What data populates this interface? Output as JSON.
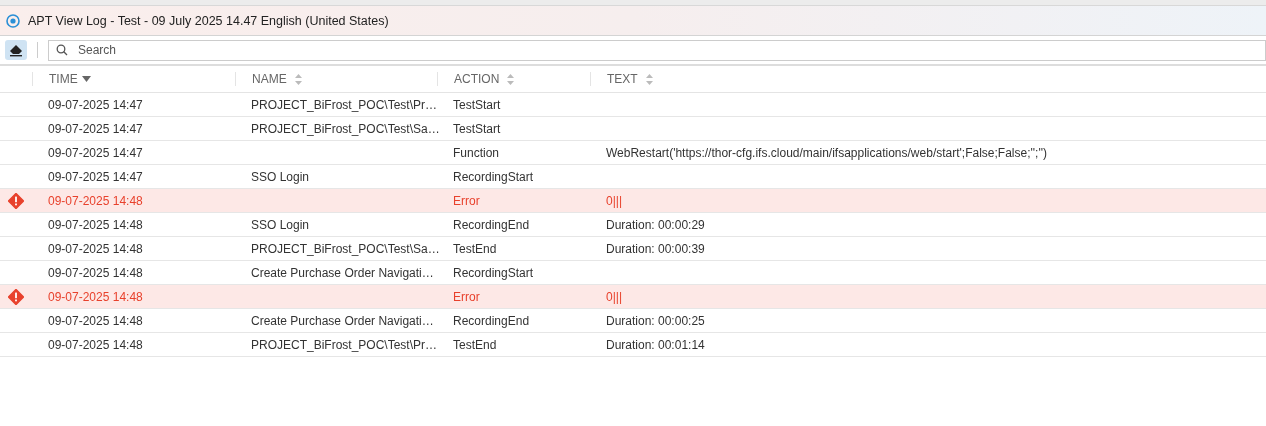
{
  "window": {
    "title": "APT View Log - Test - 09 July 2025 14.47 English (United States)"
  },
  "search": {
    "placeholder": "Search"
  },
  "table": {
    "columns": [
      {
        "label": "TIME",
        "sorted": true
      },
      {
        "label": "NAME",
        "sorted": false
      },
      {
        "label": "ACTION",
        "sorted": false
      },
      {
        "label": "TEXT",
        "sorted": false
      }
    ],
    "rows": [
      {
        "kind": "info",
        "time": "09-07-2025 14:47",
        "name": "PROJECT_BiFrost_POC\\Test\\Pr…",
        "action": "TestStart",
        "text": ""
      },
      {
        "kind": "info",
        "time": "09-07-2025 14:47",
        "name": "PROJECT_BiFrost_POC\\Test\\Sa…",
        "action": "TestStart",
        "text": ""
      },
      {
        "kind": "info",
        "time": "09-07-2025 14:47",
        "name": "",
        "action": "Function",
        "text": "WebRestart('https://thor-cfg.ifs.cloud/main/ifsapplications/web/start';False;False;'';'')"
      },
      {
        "kind": "info",
        "time": "09-07-2025 14:47",
        "name": "SSO Login",
        "action": "RecordingStart",
        "text": ""
      },
      {
        "kind": "error",
        "time": "09-07-2025 14:48",
        "name": "",
        "action": "Error",
        "text": "0|||"
      },
      {
        "kind": "info",
        "time": "09-07-2025 14:48",
        "name": "SSO Login",
        "action": "RecordingEnd",
        "text": "Duration: 00:00:29"
      },
      {
        "kind": "info",
        "time": "09-07-2025 14:48",
        "name": "PROJECT_BiFrost_POC\\Test\\Sa…",
        "action": "TestEnd",
        "text": "Duration: 00:00:39"
      },
      {
        "kind": "info",
        "time": "09-07-2025 14:48",
        "name": "Create Purchase Order Navigati…",
        "action": "RecordingStart",
        "text": ""
      },
      {
        "kind": "error",
        "time": "09-07-2025 14:48",
        "name": "",
        "action": "Error",
        "text": "0|||"
      },
      {
        "kind": "info",
        "time": "09-07-2025 14:48",
        "name": "Create Purchase Order Navigati…",
        "action": "RecordingEnd",
        "text": "Duration: 00:00:25"
      },
      {
        "kind": "info",
        "time": "09-07-2025 14:48",
        "name": "PROJECT_BiFrost_POC\\Test\\Pr…",
        "action": "TestEnd",
        "text": "Duration: 00:01:14"
      }
    ]
  }
}
